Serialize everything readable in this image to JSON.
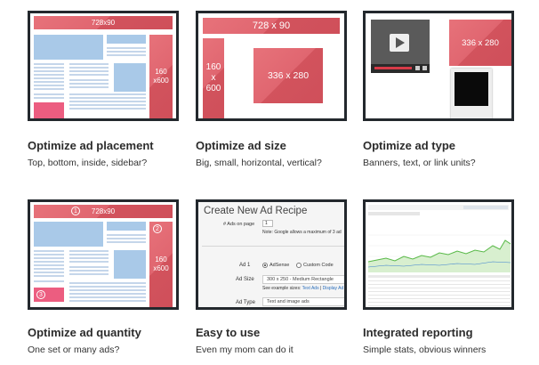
{
  "cards": [
    {
      "title": "Optimize ad placement",
      "subtitle": "Top, bottom, inside, sidebar?",
      "labels": {
        "leaderboard": "728x90",
        "skyscraper": "160 x600"
      }
    },
    {
      "title": "Optimize ad size",
      "subtitle": "Big, small, horizontal, vertical?",
      "labels": {
        "leaderboard": "728 x 90",
        "skyscraper": "160 x 600",
        "rectangle": "336 x 280"
      }
    },
    {
      "title": "Optimize ad type",
      "subtitle": "Banners, text, or link units?",
      "labels": {
        "rectangle": "336 x 280"
      }
    },
    {
      "title": "Optimize ad quantity",
      "subtitle": "One set or many ads?",
      "labels": {
        "leaderboard": "728x90",
        "skyscraper": "160 x600",
        "n1": "1",
        "n2": "2",
        "n3": "3"
      }
    },
    {
      "title": "Easy to use",
      "subtitle": "Even my mom can do it",
      "recipe": {
        "heading": "Create New Ad Recipe",
        "ads_on_page_label": "# Ads on page",
        "ads_on_page_value": "1",
        "note": "Note: Google allows a maximum of 3 ad",
        "ad_label": "Ad 1",
        "adsense": "AdSense",
        "custom_code": "Custom Code",
        "ad_size_label": "Ad Size",
        "ad_size_value": "300 x 250 - Medium Rectangle",
        "example_prefix": "See example sizes:",
        "example_link1": "Text Ads",
        "example_link2": "Display Ad",
        "ad_type_label": "Ad Type",
        "ad_type_value": "Text and image ads"
      }
    },
    {
      "title": "Integrated reporting",
      "subtitle": "Simple stats, obvious winners"
    }
  ]
}
